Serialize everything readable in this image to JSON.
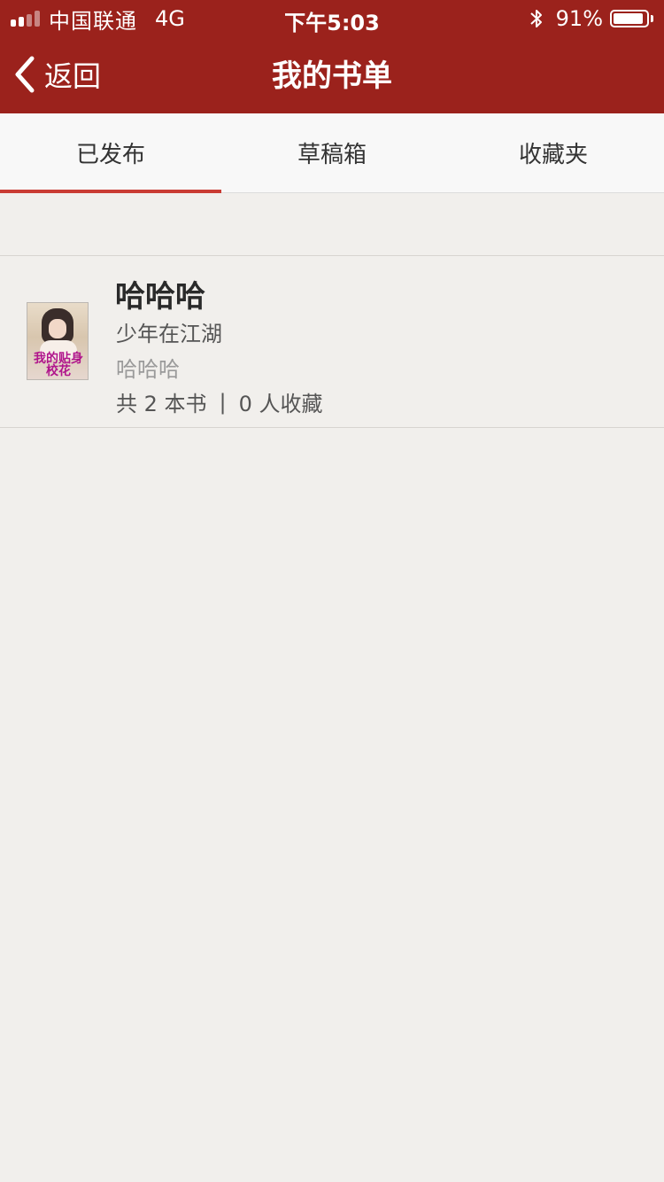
{
  "status_bar": {
    "carrier": "中国联通",
    "network": "4G",
    "time": "下午5:03",
    "battery_percent": "91%",
    "battery_level": 0.91,
    "signal_bars_filled": 2,
    "signal_bars_total": 4
  },
  "nav": {
    "back_label": "返回",
    "title": "我的书单"
  },
  "tabs": [
    {
      "label": "已发布",
      "active": true
    },
    {
      "label": "草稿箱",
      "active": false
    },
    {
      "label": "收藏夹",
      "active": false
    }
  ],
  "booklists": [
    {
      "title": "哈哈哈",
      "author": "少年在江湖",
      "description": "哈哈哈",
      "cover_text": "我的贴身校花",
      "stats": {
        "book_count": "共 2 本书",
        "separator": "|",
        "favorites": "0 人收藏"
      }
    }
  ],
  "colors": {
    "header_bg": "#9b221c",
    "tab_indicator": "#c93b33",
    "page_bg": "#f1efec"
  }
}
